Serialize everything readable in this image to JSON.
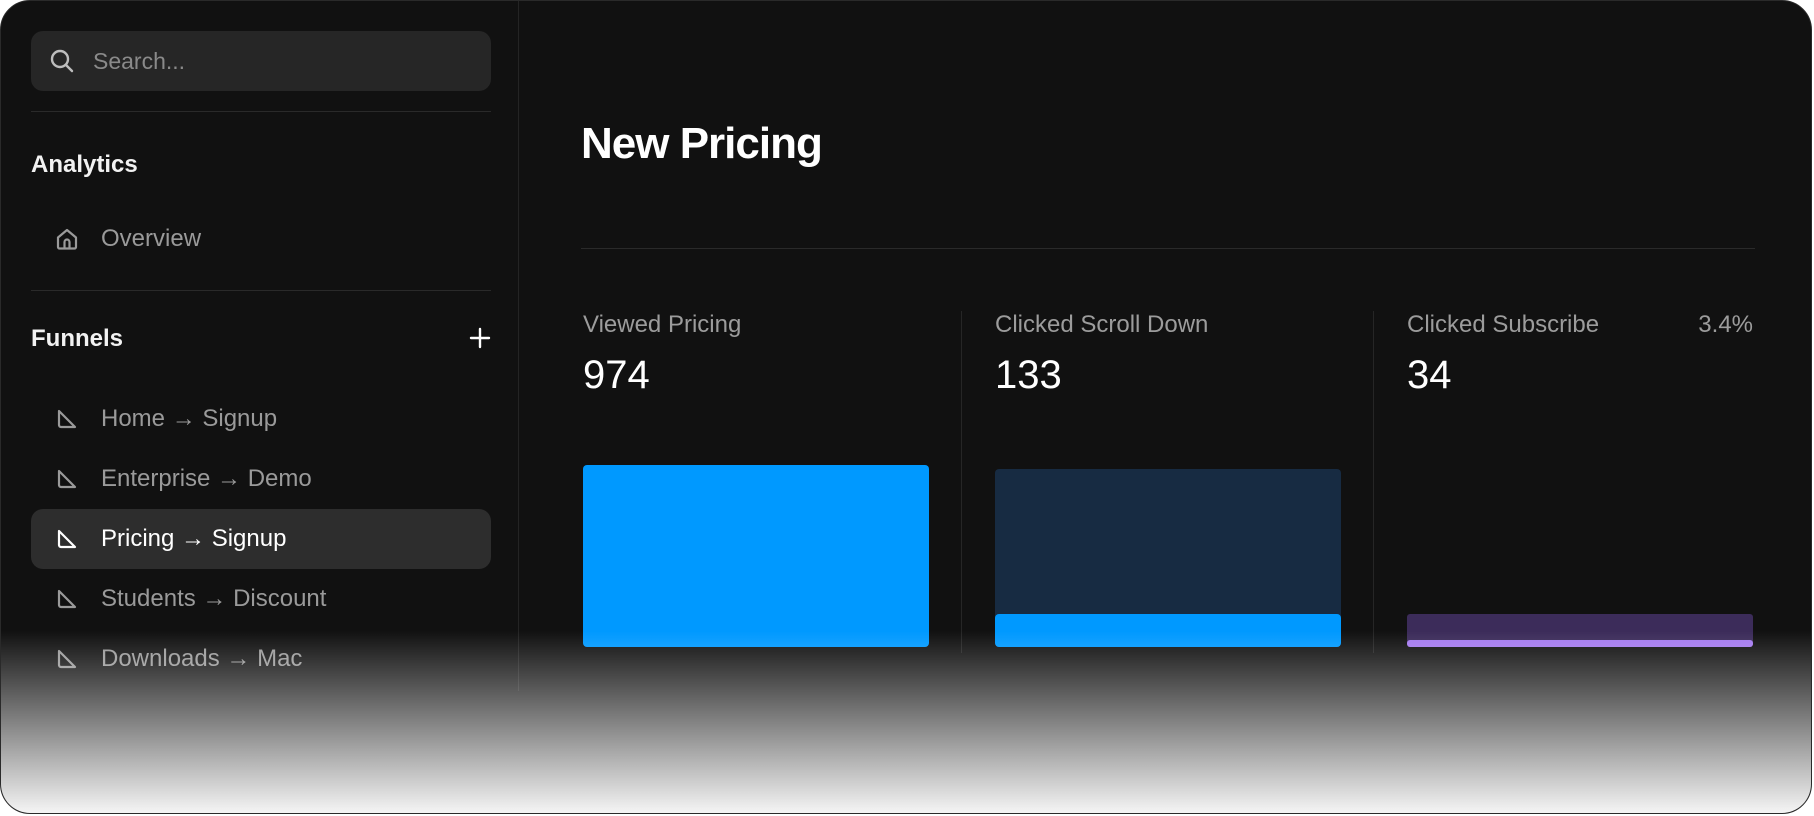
{
  "search": {
    "placeholder": "Search..."
  },
  "sidebar": {
    "analytics_title": "Analytics",
    "overview_label": "Overview",
    "funnels_title": "Funnels",
    "funnels": [
      {
        "label": "Home → Signup",
        "active": false
      },
      {
        "label": "Enterprise → Demo",
        "active": false
      },
      {
        "label": "Pricing → Signup",
        "active": true
      },
      {
        "label": "Students → Discount",
        "active": false
      },
      {
        "label": "Downloads → Mac",
        "active": false
      }
    ]
  },
  "main": {
    "title": "New Pricing",
    "steps": [
      {
        "label": "Viewed Pricing",
        "value": "974",
        "percent": ""
      },
      {
        "label": "Clicked Scroll Down",
        "value": "133",
        "percent": ""
      },
      {
        "label": "Clicked Subscribe",
        "value": "34",
        "percent": "3.4%"
      }
    ]
  },
  "colors": {
    "accent": "#0099FF",
    "accent_track": "#172B42",
    "purple": "#A57BEF",
    "purple_track": "#3C2C5A"
  }
}
